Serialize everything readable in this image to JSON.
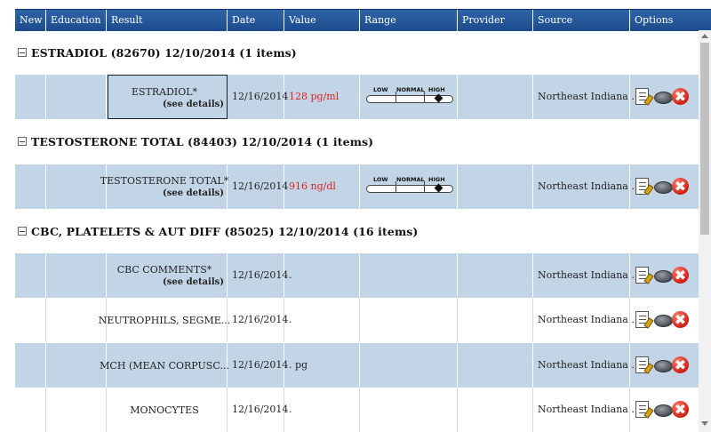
{
  "header": {
    "columns": [
      "New",
      "Education",
      "Result",
      "Date",
      "Value",
      "Range",
      "Provider",
      "Source",
      "Options"
    ]
  },
  "groups": [
    {
      "title": "ESTRADIOL (82670) 12/10/2014 (1 items)"
    },
    {
      "title": "TESTOSTERONE TOTAL (84403) 12/10/2014 (1 items)"
    },
    {
      "title": "CBC, PLATELETS & AUT DIFF (85025) 12/10/2014 (16 items)"
    }
  ],
  "rows": [
    {
      "result": "ESTRADIOL*",
      "details": "(see details)",
      "date": "12/16/2014",
      "value": "128 pg/ml",
      "source": "Northeast Indiana ..."
    },
    {
      "result": "TESTOSTERONE TOTAL*",
      "details": "(see details)",
      "date": "12/16/2014",
      "value": "916 ng/dl",
      "source": "Northeast Indiana ..."
    },
    {
      "result": "CBC COMMENTS*",
      "details": "(see details)",
      "date": "12/16/2014",
      "value": ".",
      "source": "Northeast Indiana ..."
    },
    {
      "result": "NEUTROPHILS, SEGME...",
      "date": "12/16/2014",
      "value": ".",
      "source": "Northeast Indiana ..."
    },
    {
      "result": "MCH (MEAN CORPUSC...",
      "date": "12/16/2014",
      "value": ". pg",
      "source": "Northeast Indiana ..."
    },
    {
      "result": "MONOCYTES",
      "date": "12/16/2014",
      "value": ".",
      "source": "Northeast Indiana ..."
    }
  ],
  "range_labels": {
    "low": "LOW",
    "normal": "NORMAL",
    "high": "HIGH"
  },
  "icons": {
    "edit": "edit-document-icon",
    "disk": "archive-icon",
    "delete": "delete-icon"
  },
  "colors": {
    "header": "#1c4b8c",
    "row_shaded": "#c2d5e7",
    "value_abnormal": "#e02020",
    "delete": "#d01f12"
  }
}
